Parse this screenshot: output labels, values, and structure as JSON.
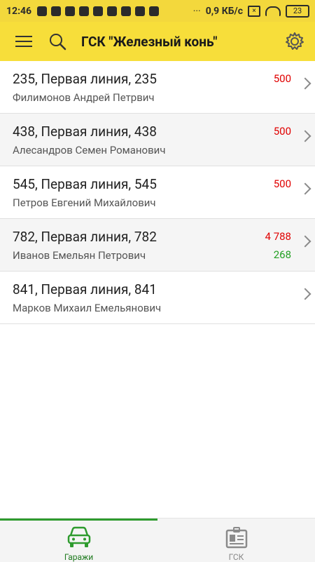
{
  "status_bar": {
    "time": "12:46",
    "speed": "0,9 КБ/с",
    "battery": "23",
    "sim_icon": "x-box-icon"
  },
  "toolbar": {
    "title": "ГСК \"Железный конь\""
  },
  "garages": [
    {
      "address": "235, Первая линия, 235",
      "owner": "Филимонов Андрей Петрвич",
      "debt": "500",
      "credit": ""
    },
    {
      "address": "438, Первая линия, 438",
      "owner": "Алесандров Семен Романович",
      "debt": "500",
      "credit": ""
    },
    {
      "address": "545, Первая линия, 545",
      "owner": "Петров Евгений Михайлович",
      "debt": "500",
      "credit": ""
    },
    {
      "address": "782, Первая линия, 782",
      "owner": "Иванов Емельян Петрович",
      "debt": "4 788",
      "credit": "268"
    },
    {
      "address": "841, Первая линия, 841",
      "owner": "Марков Михаил Емельянович",
      "debt": "",
      "credit": ""
    }
  ],
  "bottom_nav": {
    "tabs": [
      {
        "label": "Гаражи",
        "icon": "car-icon",
        "active": true
      },
      {
        "label": "ГСК",
        "icon": "badge-icon",
        "active": false
      }
    ]
  },
  "colors": {
    "accent_yellow": "#f7de3a",
    "debt_red": "#e00000",
    "credit_green": "#23a023",
    "tab_active_green": "#2e9b2e"
  }
}
